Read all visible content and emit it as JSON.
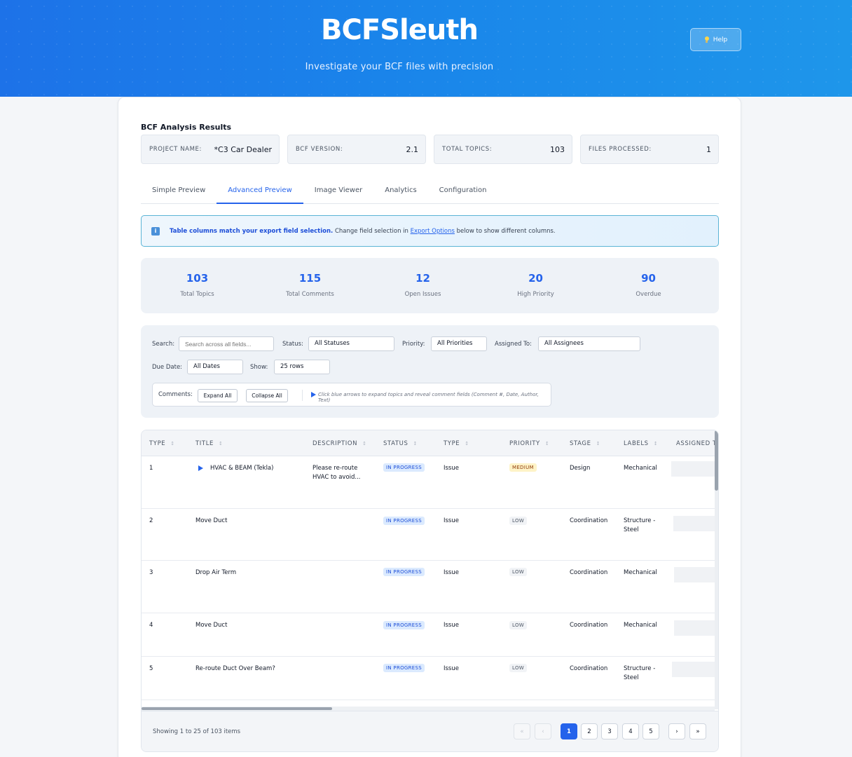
{
  "header": {
    "title": "BCFSleuth",
    "subtitle": "Investigate your BCF files with precision",
    "help_label": "Help"
  },
  "results": {
    "title": "BCF Analysis Results",
    "stats": [
      {
        "label": "PROJECT NAME:",
        "value": "*C3 Car Dealer"
      },
      {
        "label": "BCF VERSION:",
        "value": "2.1"
      },
      {
        "label": "TOTAL TOPICS:",
        "value": "103"
      },
      {
        "label": "FILES PROCESSED:",
        "value": "1"
      }
    ]
  },
  "tabs": [
    "Simple Preview",
    "Advanced Preview",
    "Image Viewer",
    "Analytics",
    "Configuration"
  ],
  "active_tab": "Advanced Preview",
  "info": {
    "bold": "Table columns match your export field selection.",
    "text_before": " Change field selection in ",
    "link": "Export Options",
    "text_after": " below to show different columns."
  },
  "summary": [
    {
      "value": "103",
      "label": "Total Topics"
    },
    {
      "value": "115",
      "label": "Total Comments"
    },
    {
      "value": "12",
      "label": "Open Issues"
    },
    {
      "value": "20",
      "label": "High Priority"
    },
    {
      "value": "90",
      "label": "Overdue"
    }
  ],
  "filters": {
    "search_label": "Search:",
    "search_placeholder": "Search across all fields...",
    "status_label": "Status:",
    "status_value": "All Statuses",
    "priority_label": "Priority:",
    "priority_value": "All Priorities",
    "assigned_label": "Assigned To:",
    "assigned_value": "All Assignees",
    "due_label": "Due Date:",
    "due_value": "All Dates",
    "show_label": "Show:",
    "show_value": "25 rows",
    "comments_label": "Comments:",
    "expand_all": "Expand All",
    "collapse_all": "Collapse All",
    "hint": "Click blue arrows to expand topics and reveal comment fields (Comment #, Date, Author, Text)"
  },
  "table": {
    "columns": [
      "TYPE",
      "TITLE",
      "DESCRIPTION",
      "STATUS",
      "TYPE",
      "PRIORITY",
      "STAGE",
      "LABELS",
      "ASSIGNED T"
    ],
    "rows": [
      {
        "num": "1",
        "title": "HVAC & BEAM (Tekla)",
        "desc1": "Please re-route",
        "desc2": "HVAC to avoid...",
        "status": "IN PROGRESS",
        "type": "Issue",
        "priority": "MEDIUM",
        "stage": "Design",
        "label1": "Mechanical",
        "label2": ""
      },
      {
        "num": "2",
        "title": "Move Duct",
        "desc1": "",
        "desc2": "",
        "status": "IN PROGRESS",
        "type": "Issue",
        "priority": "LOW",
        "stage": "Coordination",
        "label1": "Structure -",
        "label2": "Steel"
      },
      {
        "num": "3",
        "title": "Drop Air Term",
        "desc1": "",
        "desc2": "",
        "status": "IN PROGRESS",
        "type": "Issue",
        "priority": "LOW",
        "stage": "Coordination",
        "label1": "Mechanical",
        "label2": ""
      },
      {
        "num": "4",
        "title": "Move Duct",
        "desc1": "",
        "desc2": "",
        "status": "IN PROGRESS",
        "type": "Issue",
        "priority": "LOW",
        "stage": "Coordination",
        "label1": "Mechanical",
        "label2": ""
      },
      {
        "num": "5",
        "title": "Re-route Duct Over Beam?",
        "desc1": "",
        "desc2": "",
        "status": "IN PROGRESS",
        "type": "Issue",
        "priority": "LOW",
        "stage": "Coordination",
        "label1": "Structure -",
        "label2": "Steel"
      }
    ]
  },
  "pagination": {
    "showing": "Showing 1 to 25 of 103 items",
    "first": "«",
    "prev": "‹",
    "pages": [
      "1",
      "2",
      "3",
      "4",
      "5"
    ],
    "current": "1",
    "next": "›",
    "last": "»"
  }
}
